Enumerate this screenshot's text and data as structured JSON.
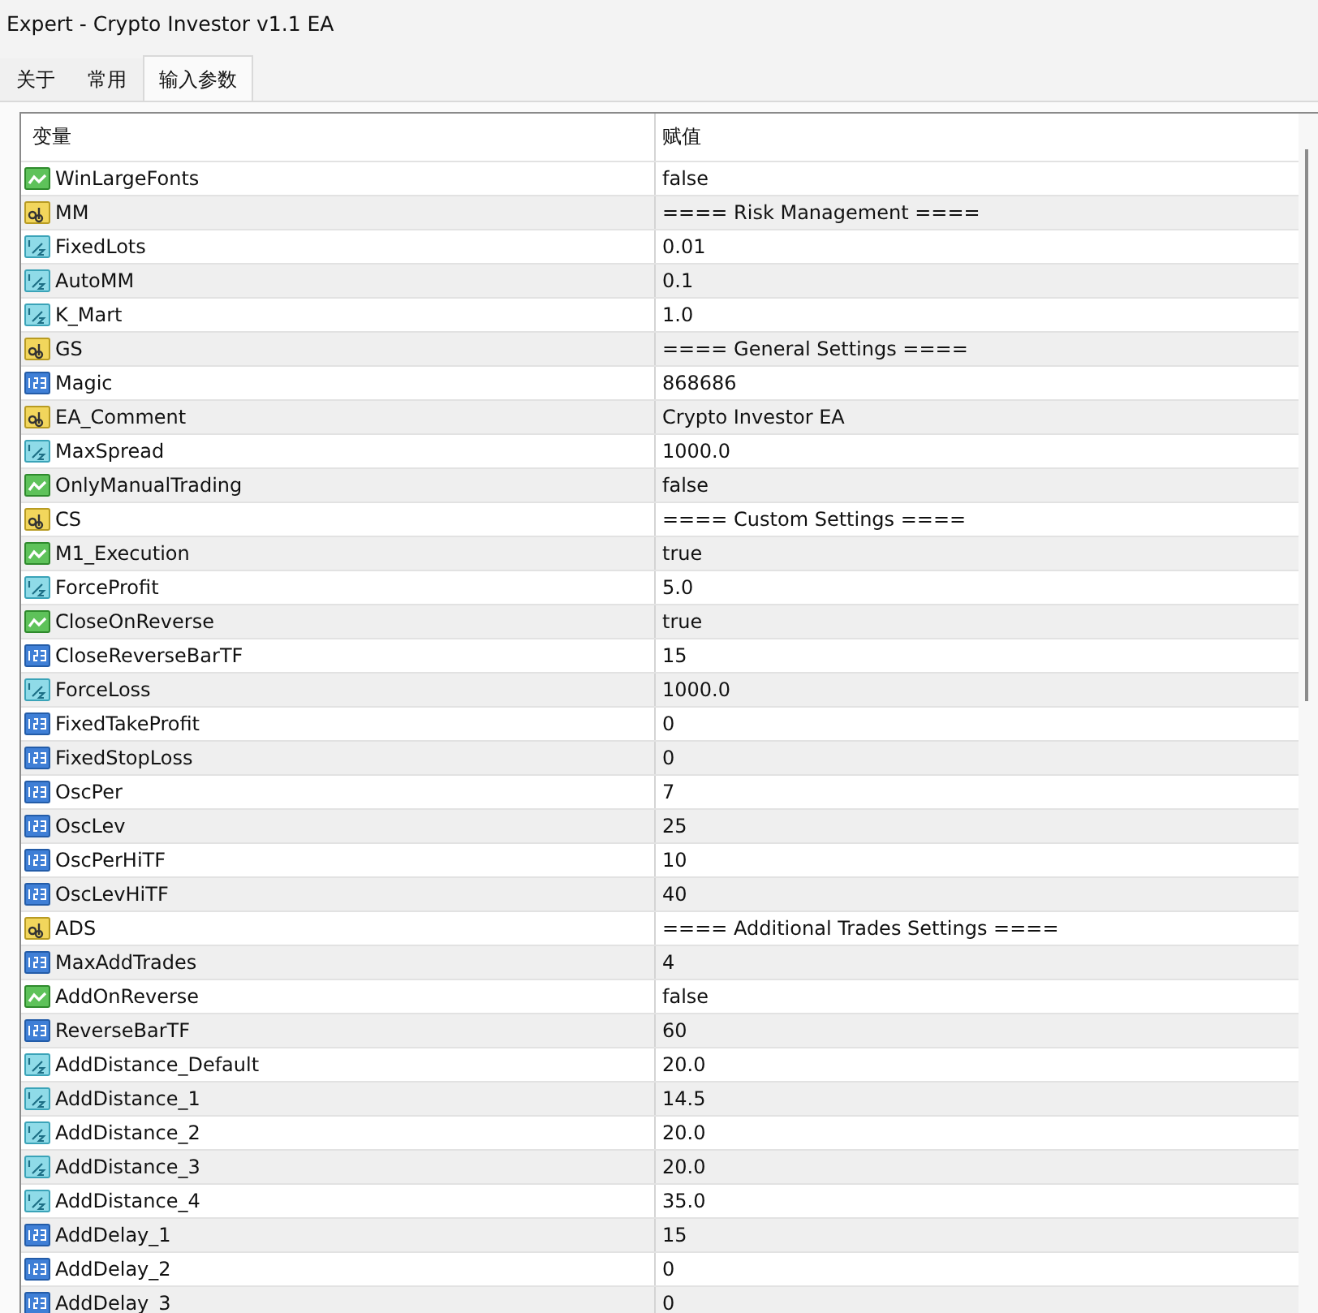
{
  "window": {
    "title": "Expert - Crypto Investor v1.1 EA"
  },
  "tabs": [
    {
      "label": "关于",
      "selected": false
    },
    {
      "label": "常用",
      "selected": false
    },
    {
      "label": "输入参数",
      "selected": true
    }
  ],
  "table": {
    "columns": [
      "变量",
      "赋值"
    ],
    "rows": [
      {
        "kind": "bool",
        "name": "WinLargeFonts",
        "value": "false"
      },
      {
        "kind": "string",
        "name": "MM",
        "value": "==== Risk Management ===="
      },
      {
        "kind": "double",
        "name": "FixedLots",
        "value": "0.01"
      },
      {
        "kind": "double",
        "name": "AutoMM",
        "value": "0.1"
      },
      {
        "kind": "double",
        "name": "K_Mart",
        "value": "1.0"
      },
      {
        "kind": "string",
        "name": "GS",
        "value": "==== General Settings ===="
      },
      {
        "kind": "int",
        "name": "Magic",
        "value": "868686"
      },
      {
        "kind": "string",
        "name": "EA_Comment",
        "value": "Crypto Investor EA"
      },
      {
        "kind": "double",
        "name": "MaxSpread",
        "value": "1000.0"
      },
      {
        "kind": "bool",
        "name": "OnlyManualTrading",
        "value": "false"
      },
      {
        "kind": "string",
        "name": "CS",
        "value": "==== Custom Settings ===="
      },
      {
        "kind": "bool",
        "name": "M1_Execution",
        "value": "true"
      },
      {
        "kind": "double",
        "name": "ForceProfit",
        "value": "5.0"
      },
      {
        "kind": "bool",
        "name": "CloseOnReverse",
        "value": "true"
      },
      {
        "kind": "int",
        "name": "CloseReverseBarTF",
        "value": "15"
      },
      {
        "kind": "double",
        "name": "ForceLoss",
        "value": "1000.0"
      },
      {
        "kind": "int",
        "name": "FixedTakeProfit",
        "value": "0"
      },
      {
        "kind": "int",
        "name": "FixedStopLoss",
        "value": "0"
      },
      {
        "kind": "int",
        "name": "OscPer",
        "value": "7"
      },
      {
        "kind": "int",
        "name": "OscLev",
        "value": "25"
      },
      {
        "kind": "int",
        "name": "OscPerHiTF",
        "value": "10"
      },
      {
        "kind": "int",
        "name": "OscLevHiTF",
        "value": "40"
      },
      {
        "kind": "string",
        "name": "ADS",
        "value": "==== Additional Trades Settings ===="
      },
      {
        "kind": "int",
        "name": "MaxAddTrades",
        "value": "4"
      },
      {
        "kind": "bool",
        "name": "AddOnReverse",
        "value": "false"
      },
      {
        "kind": "int",
        "name": "ReverseBarTF",
        "value": "60"
      },
      {
        "kind": "double",
        "name": "AddDistance_Default",
        "value": "20.0"
      },
      {
        "kind": "double",
        "name": "AddDistance_1",
        "value": "14.5"
      },
      {
        "kind": "double",
        "name": "AddDistance_2",
        "value": "20.0"
      },
      {
        "kind": "double",
        "name": "AddDistance_3",
        "value": "20.0"
      },
      {
        "kind": "double",
        "name": "AddDistance_4",
        "value": "35.0"
      },
      {
        "kind": "int",
        "name": "AddDelay_1",
        "value": "15"
      },
      {
        "kind": "int",
        "name": "AddDelay_2",
        "value": "0"
      },
      {
        "kind": "int",
        "name": "AddDelay_3",
        "value": "0"
      }
    ]
  }
}
